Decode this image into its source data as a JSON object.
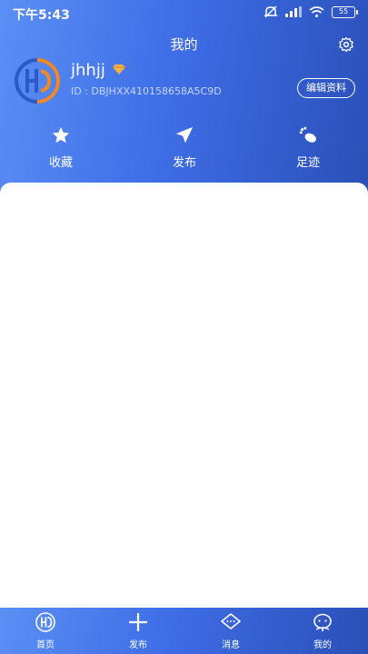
{
  "status_bar": {
    "time": "下午5:43",
    "battery": "55"
  },
  "header": {
    "title": "我的"
  },
  "profile": {
    "username": "jhhjj",
    "id": "ID : DBJHXX410158658A5C9D",
    "edit_label": "编辑资料"
  },
  "actions": [
    {
      "label": "收藏",
      "icon": "star-icon"
    },
    {
      "label": "发布",
      "icon": "send-icon"
    },
    {
      "label": "足迹",
      "icon": "footprint-icon"
    }
  ],
  "tabs": [
    {
      "label": "首页",
      "icon": "home-logo-icon"
    },
    {
      "label": "发布",
      "icon": "plus-icon"
    },
    {
      "label": "消息",
      "icon": "message-icon"
    },
    {
      "label": "我的",
      "icon": "profile-icon"
    }
  ],
  "colors": {
    "primary": "#3f6ee6",
    "accent": "#f08a24",
    "card": "#ffffff"
  }
}
